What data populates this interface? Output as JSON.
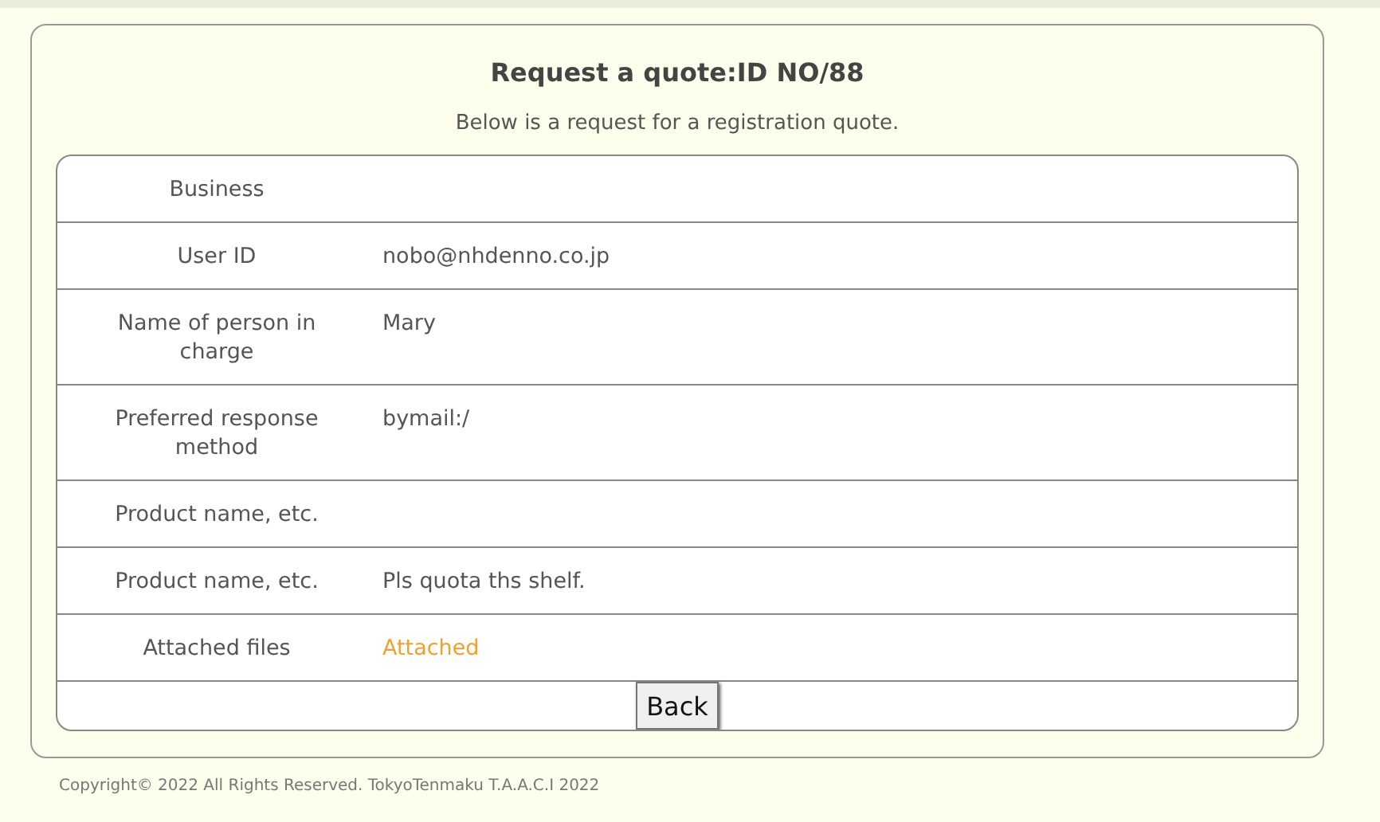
{
  "title": "Request a quote:ID NO/88",
  "subtitle": "Below is a request for a registration quote.",
  "rows": [
    {
      "label": "Business",
      "value": "",
      "kind": "text"
    },
    {
      "label": "User ID",
      "value": "nobo@nhdenno.co.jp",
      "kind": "text"
    },
    {
      "label": "Name of person in charge",
      "value": "Mary",
      "kind": "text"
    },
    {
      "label": "Preferred response method",
      "value": "bymail:/",
      "kind": "text"
    },
    {
      "label": "Product name, etc.",
      "value": "",
      "kind": "text"
    },
    {
      "label": "Product name, etc.",
      "value": "Pls quota ths shelf.",
      "kind": "text"
    },
    {
      "label": "Attached files",
      "value": "Attached",
      "kind": "link"
    }
  ],
  "button": "Back",
  "footer": "Copyright© 2022 All Rights Reserved. TokyoTenmaku T.A.A.C.I 2022"
}
